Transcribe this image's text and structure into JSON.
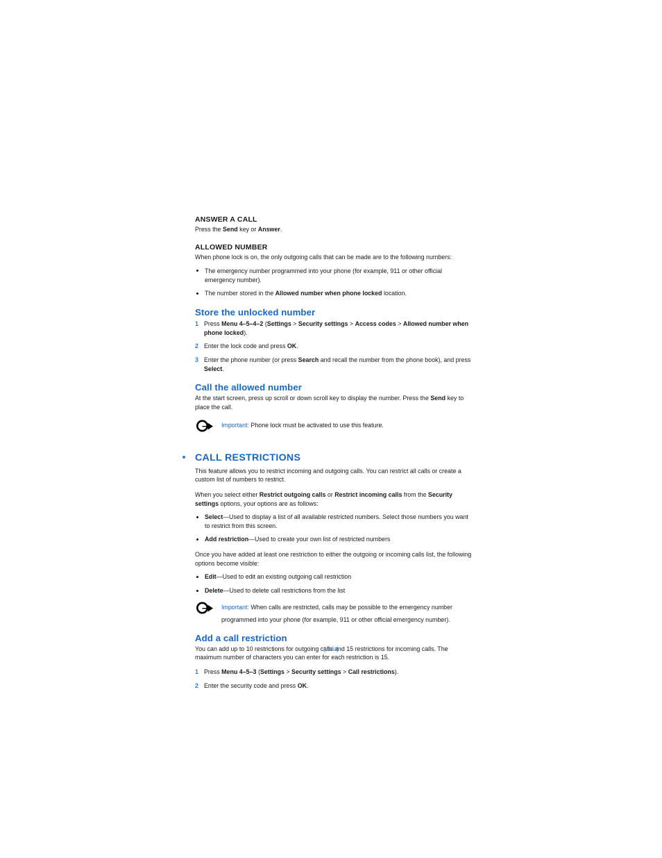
{
  "page": {
    "folio": "[ 56 ]"
  },
  "sections": {
    "answer_a_call": {
      "heading": "ANSWER A CALL",
      "body_parts": [
        "Press the ",
        "Send",
        " key or ",
        "Answer",
        "."
      ]
    },
    "allowed_number": {
      "heading": "ALLOWED NUMBER",
      "intro": "When phone lock is on, the only outgoing calls that can be made are to the following numbers:",
      "bullets": [
        {
          "parts": [
            "The emergency number programmed into your phone (for example, 911 or other official emergency number)."
          ]
        },
        {
          "pre": "The number stored in the ",
          "bold": "Allowed number when phone locked",
          "post": " location."
        }
      ]
    },
    "store_unlocked_number": {
      "heading": "Store the unlocked number",
      "steps": [
        {
          "num": "1",
          "pre": "Press ",
          "bold1": "Menu 4–5–4–2",
          "mid1": " (",
          "bold2": "Settings",
          "gt1": " > ",
          "bold3": "Security settings",
          "gt2": " > ",
          "bold4": "Access codes",
          "gt3": " > ",
          "bold5": "Allowed number when phone locked",
          "post": ")."
        },
        {
          "num": "2",
          "pre": "Enter the lock code and press ",
          "bold1": "OK",
          "post": "."
        },
        {
          "num": "3",
          "pre": "Enter the phone number (or press ",
          "bold1": "Search",
          "mid1": " and recall the number from the phone book), and press ",
          "bold2": "Select",
          "post": "."
        }
      ]
    },
    "call_allowed_number": {
      "heading": "Call the allowed number",
      "body": {
        "pre": "At the start screen, press up scroll or down scroll key to display the number. Press the ",
        "bold": "Send",
        "post": " key to place the call."
      },
      "important": {
        "label": "Important:",
        "text": " Phone lock must be activated to use this feature.",
        "icon": "important-arrow-icon"
      }
    },
    "call_restrictions": {
      "heading": "CALL RESTRICTIONS",
      "bullet_marker": "section-bullet",
      "para1": "This feature allows you to restrict incoming and outgoing calls. You can restrict all calls or create a custom list of numbers to restrict.",
      "para2": {
        "pre": "When you select either ",
        "bold1": "Restrict outgoing calls",
        "mid1": " or ",
        "bold2": "Restrict incoming calls",
        "mid2": " from the ",
        "bold3": "Security settings",
        "post": " options, your options are as follows:"
      },
      "options": [
        {
          "bold": "Select",
          "text": "—Used to display a list of all available restricted numbers. Select those numbers you want to restrict from this screen."
        },
        {
          "bold": "Add restriction",
          "text": "—Used to create your own list of restricted numbers"
        }
      ],
      "para3": "Once you have added at least one restriction to either the outgoing or incoming calls list, the following options become visible:",
      "options2": [
        {
          "bold": "Edit",
          "text": "—Used to edit an existing outgoing call restriction"
        },
        {
          "bold": "Delete",
          "text": "—Used to delete call restrictions from the list"
        }
      ],
      "important": {
        "label": "Important:",
        "text": " When calls are restricted, calls may be possible to the emergency number programmed into your phone (for example, 911 or other official emergency number).",
        "icon": "important-arrow-icon"
      }
    },
    "add_call_restriction": {
      "heading": "Add a call restriction",
      "body": "You can add up to 10 restrictions for outgoing calls and 15 restrictions for incoming calls. The maximum number of characters you can enter for each restriction is 15.",
      "steps": [
        {
          "num": "1",
          "pre": "Press ",
          "bold1": "Menu 4–5–3",
          "mid1": " (",
          "bold2": "Settings",
          "gt1": " > ",
          "bold3": "Security settings",
          "gt2": " > ",
          "bold4": "Call restrictions",
          "post": ")."
        },
        {
          "num": "2",
          "pre": "Enter the security code and press ",
          "bold1": "OK",
          "post": "."
        }
      ]
    }
  },
  "colors": {
    "heading_blue": "#1469c7",
    "accent_blue": "#2b7fd4",
    "body_black": "#1a1a1a"
  }
}
